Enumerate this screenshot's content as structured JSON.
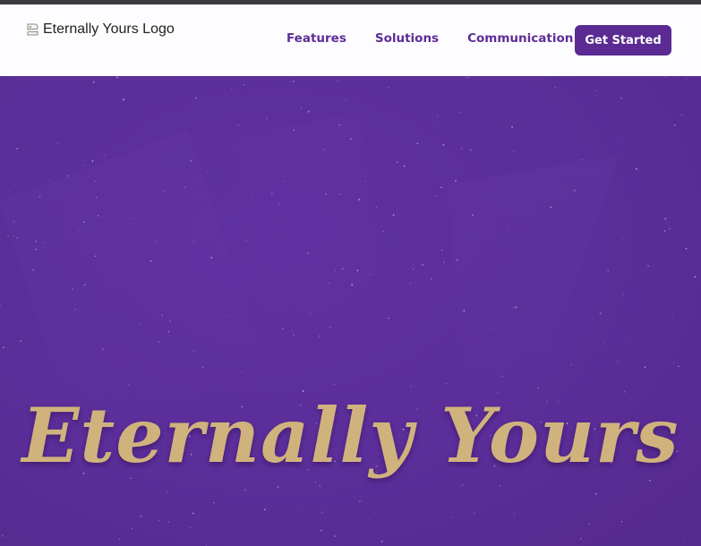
{
  "brand": {
    "logo_alt": "Eternally Yours Logo"
  },
  "nav": {
    "links": [
      "Features",
      "Solutions",
      "Communication"
    ],
    "cta_label": "Get Started"
  },
  "hero": {
    "title": "Eternally Yours"
  },
  "colors": {
    "nav_background": "#fdfcfe",
    "nav_link": "#5e2d96",
    "cta_background": "#5b2a92",
    "hero_background": "#5b2e99",
    "title_gold": "#d0b37c"
  }
}
